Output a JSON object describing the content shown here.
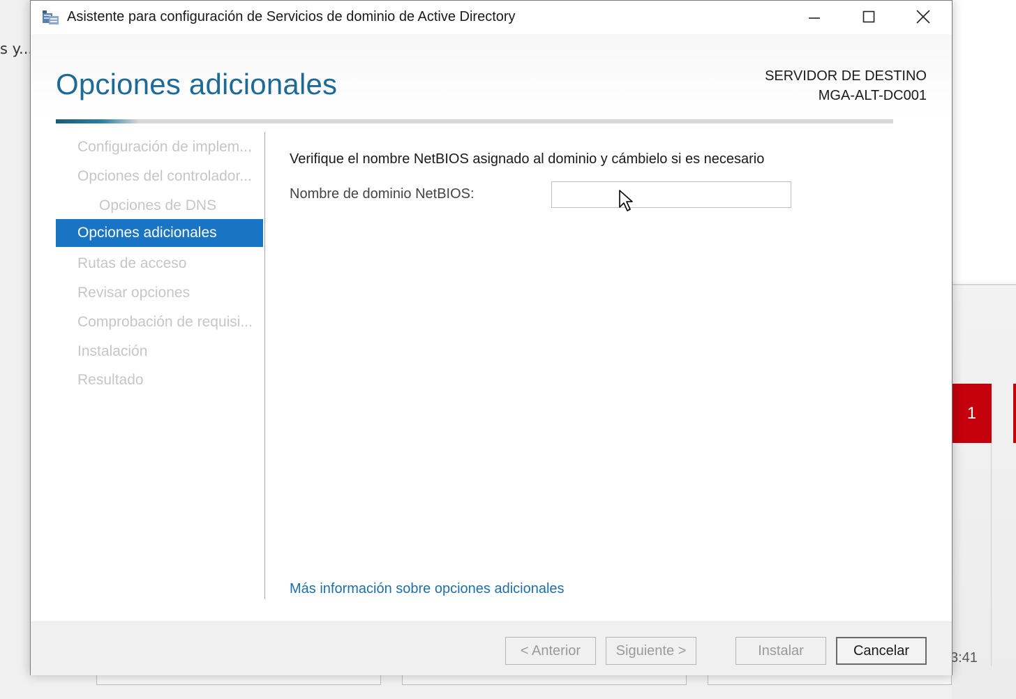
{
  "background": {
    "left_text": "s y...",
    "tile_count": "1",
    "clock": "3:41"
  },
  "window": {
    "title": "Asistente para configuración de Servicios de dominio de Active Directory",
    "controls": {
      "minimize_icon": "minimize-icon",
      "maximize_icon": "maximize-icon",
      "close_icon": "close-icon"
    }
  },
  "header": {
    "heading": "Opciones adicionales",
    "server_label": "SERVIDOR DE DESTINO",
    "server_name": "MGA-ALT-DC001",
    "progress_fraction": 0.1
  },
  "nav": {
    "items": [
      {
        "label": "Configuración de implem...",
        "state": "disabled"
      },
      {
        "label": "Opciones del controlador...",
        "state": "disabled"
      },
      {
        "label": "Opciones de DNS",
        "state": "disabled"
      },
      {
        "label": "Opciones adicionales",
        "state": "active"
      },
      {
        "label": "Rutas de acceso",
        "state": "disabled"
      },
      {
        "label": "Revisar opciones",
        "state": "disabled"
      },
      {
        "label": "Comprobación de requisi...",
        "state": "disabled"
      },
      {
        "label": "Instalación",
        "state": "disabled"
      },
      {
        "label": "Resultado",
        "state": "disabled"
      }
    ]
  },
  "main": {
    "instruction": "Verifique el nombre NetBIOS asignado al dominio y cámbielo si es necesario",
    "netbios_label": "Nombre de dominio NetBIOS:",
    "netbios_value": "",
    "more_info_link": "Más información sobre opciones adicionales"
  },
  "footer": {
    "back_label": "< Anterior",
    "next_label": "Siguiente >",
    "install_label": "Instalar",
    "cancel_label": "Cancelar"
  },
  "colors": {
    "accent": "#1a74c4",
    "heading": "#1d6a96",
    "link": "#1e6fa8",
    "alert_tile": "#c4000c"
  }
}
